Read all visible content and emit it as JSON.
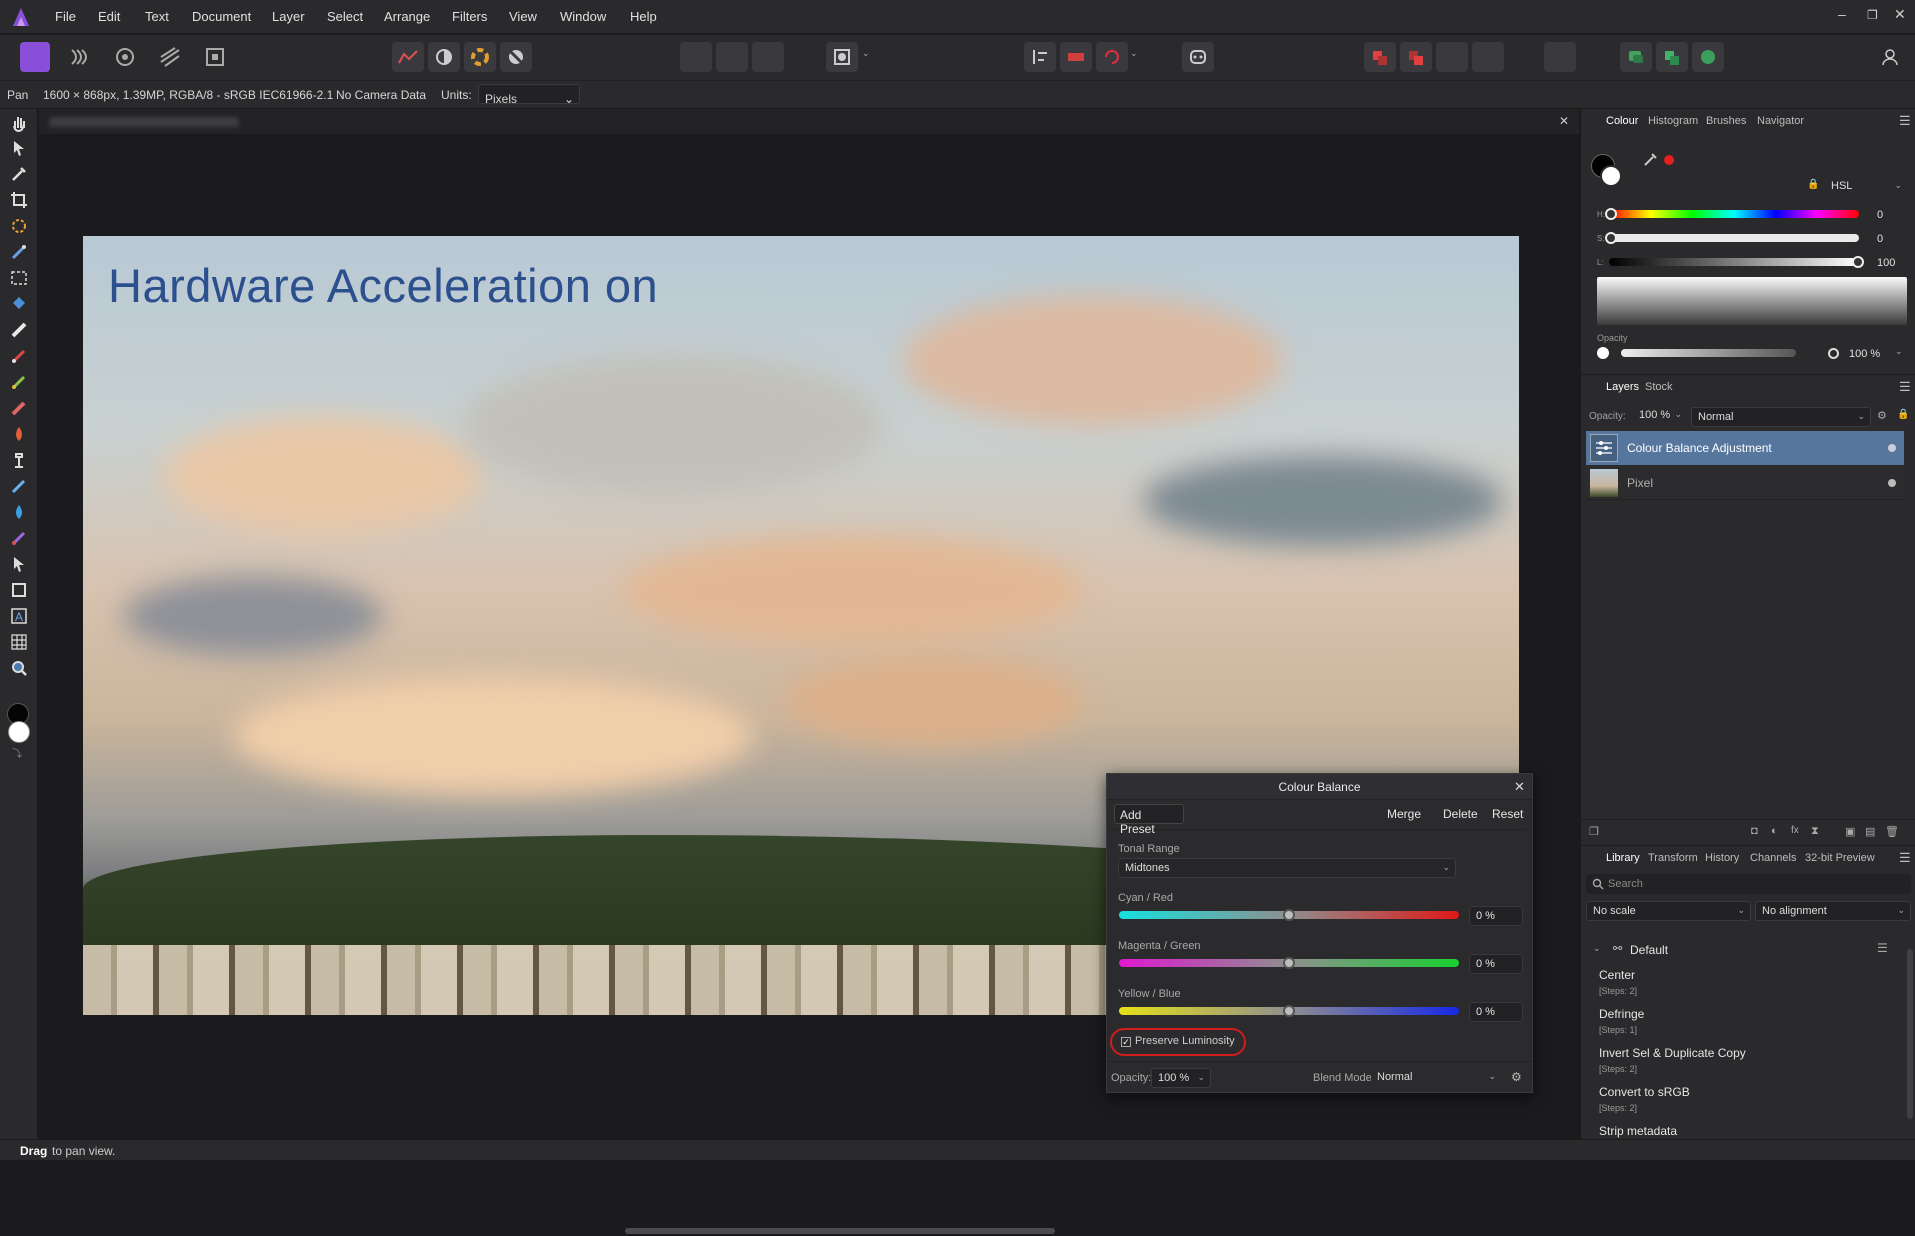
{
  "menu": [
    "File",
    "Edit",
    "Text",
    "Document",
    "Layer",
    "Select",
    "Arrange",
    "Filters",
    "View",
    "Window",
    "Help"
  ],
  "context": {
    "tool": "Pan",
    "doc_info": "1600 × 868px, 1.39MP, RGBA/8 - sRGB IEC61966-2.1",
    "camera": "No Camera Data",
    "units_label": "Units:",
    "units_value": "Pixels"
  },
  "canvas": {
    "overlay_text": "Hardware Acceleration on"
  },
  "status": {
    "bold": "Drag",
    "rest": "to pan view."
  },
  "colour_panel": {
    "tabs": [
      "Colour",
      "Histogram",
      "Brushes",
      "Navigator"
    ],
    "mode": "HSL",
    "h_label": "H:",
    "h_value": "0",
    "s_label": "S:",
    "s_value": "0",
    "l_label": "L:",
    "l_value": "100",
    "opacity_label": "Opacity",
    "opacity_value": "100 %"
  },
  "layers_panel": {
    "tabs": [
      "Layers",
      "Stock"
    ],
    "opacity_label": "Opacity:",
    "opacity_value": "100 %",
    "blend": "Normal",
    "layers": [
      {
        "name": "Colour Balance Adjustment",
        "selected": true
      },
      {
        "name": "Pixel",
        "selected": false
      }
    ]
  },
  "library_panel": {
    "tabs": [
      "Library",
      "Transform",
      "History",
      "Channels",
      "32-bit Preview"
    ],
    "search_placeholder": "Search",
    "scale": "No scale",
    "alignment": "No alignment",
    "category": "Default",
    "items": [
      {
        "name": "Center",
        "steps": "[Steps: 2]"
      },
      {
        "name": "Defringe",
        "steps": "[Steps: 1]"
      },
      {
        "name": "Invert Sel & Duplicate Copy",
        "steps": "[Steps: 2]"
      },
      {
        "name": "Convert to sRGB",
        "steps": "[Steps: 2]"
      },
      {
        "name": "Strip metadata",
        "steps": ""
      }
    ]
  },
  "dialog": {
    "title": "Colour Balance",
    "add_preset": "Add Preset",
    "merge": "Merge",
    "delete": "Delete",
    "reset": "Reset",
    "tonal_range_label": "Tonal Range",
    "tonal_range_value": "Midtones",
    "cyan_red_label": "Cyan / Red",
    "cyan_red_value": "0 %",
    "magenta_green_label": "Magenta / Green",
    "magenta_green_value": "0 %",
    "yellow_blue_label": "Yellow / Blue",
    "yellow_blue_value": "0 %",
    "preserve_luminosity": "Preserve Luminosity",
    "opacity_label": "Opacity:",
    "opacity_value": "100 %",
    "blend_label": "Blend Mode:",
    "blend_value": "Normal"
  }
}
